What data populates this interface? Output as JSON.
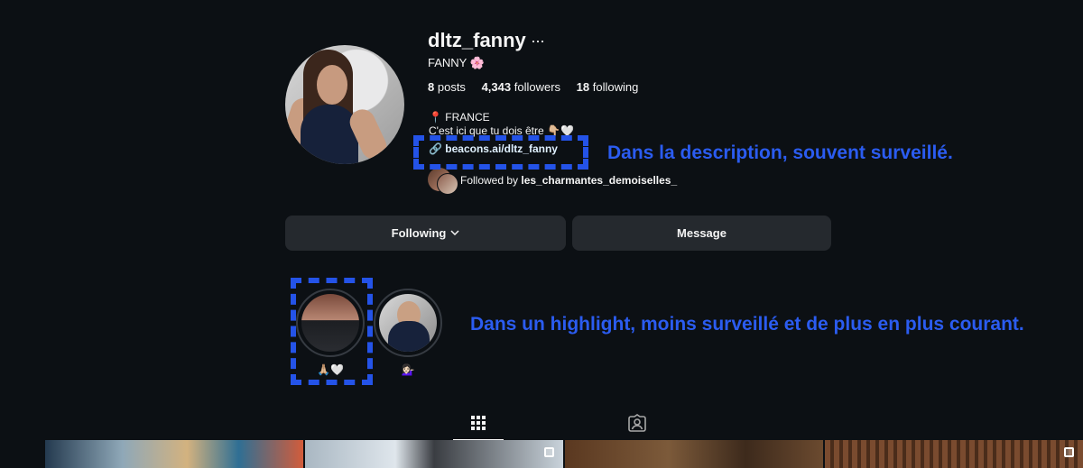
{
  "profile": {
    "username": "dltz_fanny",
    "more": "···",
    "display_name": "FANNY 🌸",
    "posts_count": "8",
    "posts_label": "posts",
    "followers_count": "4,343",
    "followers_label": "followers",
    "following_count": "18",
    "following_label": "following",
    "bio_location": "📍 FRANCE",
    "bio_text": "C'est ici que tu dois être 👇🏼🤍",
    "link": "🔗 beacons.ai/dltz_fanny",
    "followed_by_prefix": "Followed by ",
    "followed_by_user": "les_charmantes_demoiselles_"
  },
  "actions": {
    "following_label": "Following",
    "message_label": "Message"
  },
  "highlights": [
    {
      "label": "🙏🏼🤍"
    },
    {
      "label": "💁🏻‍♀️"
    }
  ],
  "annotations": {
    "description": "Dans la description, souvent surveillé.",
    "highlight": "Dans un highlight, moins surveillé et de plus en plus courant."
  },
  "tabs": [
    {
      "name": "posts-grid",
      "icon": "grid-icon"
    },
    {
      "name": "tagged",
      "icon": "tagged-person-icon"
    }
  ],
  "colors": {
    "background": "#0c1014",
    "button": "#25292e",
    "annotation": "#2b5cf0",
    "link": "#e0f1ff"
  }
}
